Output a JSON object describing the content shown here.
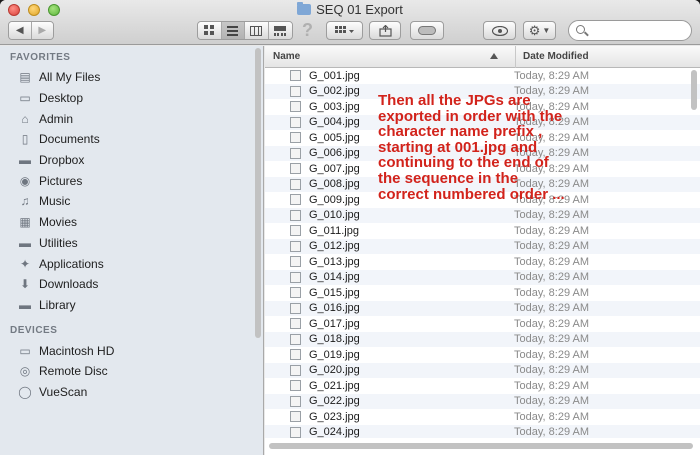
{
  "window": {
    "title": "SEQ 01 Export"
  },
  "toolbar": {
    "nav_back": "◀",
    "nav_forward": "▶",
    "help_glyph": "?",
    "view_buttons": [
      "icon-view-icon",
      "list-view-icon",
      "column-view-icon",
      "cover-flow-icon"
    ],
    "arrange_icon": "arrange-grid-icon",
    "share_icon": "share-icon",
    "tag_icon": "tag-icon",
    "quicklook_icon": "eye-icon",
    "action_icon": "gear-icon"
  },
  "search": {
    "placeholder": ""
  },
  "sidebar": {
    "favorites_header": "FAVORITES",
    "favorites": [
      {
        "label": "All My Files",
        "icon": "all-files-icon"
      },
      {
        "label": "Desktop",
        "icon": "desktop-icon"
      },
      {
        "label": "Admin",
        "icon": "home-icon"
      },
      {
        "label": "Documents",
        "icon": "documents-icon"
      },
      {
        "label": "Dropbox",
        "icon": "folder-icon"
      },
      {
        "label": "Pictures",
        "icon": "camera-icon"
      },
      {
        "label": "Music",
        "icon": "music-icon"
      },
      {
        "label": "Movies",
        "icon": "film-icon"
      },
      {
        "label": "Utilities",
        "icon": "folder-icon"
      },
      {
        "label": "Applications",
        "icon": "applications-icon"
      },
      {
        "label": "Downloads",
        "icon": "downloads-icon"
      },
      {
        "label": "Library",
        "icon": "folder-icon"
      }
    ],
    "devices_header": "DEVICES",
    "devices": [
      {
        "label": "Macintosh HD",
        "icon": "hard-drive-icon"
      },
      {
        "label": "Remote Disc",
        "icon": "disc-icon"
      },
      {
        "label": "VueScan",
        "icon": "drive-icon"
      }
    ]
  },
  "list": {
    "col_name": "Name",
    "col_date": "Date Modified",
    "rows": [
      {
        "name": "G_001.jpg",
        "date": "Today, 8:29 AM"
      },
      {
        "name": "G_002.jpg",
        "date": "Today, 8:29 AM"
      },
      {
        "name": "G_003.jpg",
        "date": "Today, 8:29 AM"
      },
      {
        "name": "G_004.jpg",
        "date": "Today, 8:29 AM"
      },
      {
        "name": "G_005.jpg",
        "date": "Today, 8:29 AM"
      },
      {
        "name": "G_006.jpg",
        "date": "Today, 8:29 AM"
      },
      {
        "name": "G_007.jpg",
        "date": "Today, 8:29 AM"
      },
      {
        "name": "G_008.jpg",
        "date": "Today, 8:29 AM"
      },
      {
        "name": "G_009.jpg",
        "date": "Today, 8:29 AM"
      },
      {
        "name": "G_010.jpg",
        "date": "Today, 8:29 AM"
      },
      {
        "name": "G_011.jpg",
        "date": "Today, 8:29 AM"
      },
      {
        "name": "G_012.jpg",
        "date": "Today, 8:29 AM"
      },
      {
        "name": "G_013.jpg",
        "date": "Today, 8:29 AM"
      },
      {
        "name": "G_014.jpg",
        "date": "Today, 8:29 AM"
      },
      {
        "name": "G_015.jpg",
        "date": "Today, 8:29 AM"
      },
      {
        "name": "G_016.jpg",
        "date": "Today, 8:29 AM"
      },
      {
        "name": "G_017.jpg",
        "date": "Today, 8:29 AM"
      },
      {
        "name": "G_018.jpg",
        "date": "Today, 8:29 AM"
      },
      {
        "name": "G_019.jpg",
        "date": "Today, 8:29 AM"
      },
      {
        "name": "G_020.jpg",
        "date": "Today, 8:29 AM"
      },
      {
        "name": "G_021.jpg",
        "date": "Today, 8:29 AM"
      },
      {
        "name": "G_022.jpg",
        "date": "Today, 8:29 AM"
      },
      {
        "name": "G_023.jpg",
        "date": "Today, 8:29 AM"
      },
      {
        "name": "G_024.jpg",
        "date": "Today, 8:29 AM"
      }
    ]
  },
  "annotation": {
    "text": "Then all the JPGs are exported in order with the character name prefix , starting at 001.jpg and continuing to the end of the sequence in the correct numbered order ...",
    "color": "#d2231b"
  }
}
